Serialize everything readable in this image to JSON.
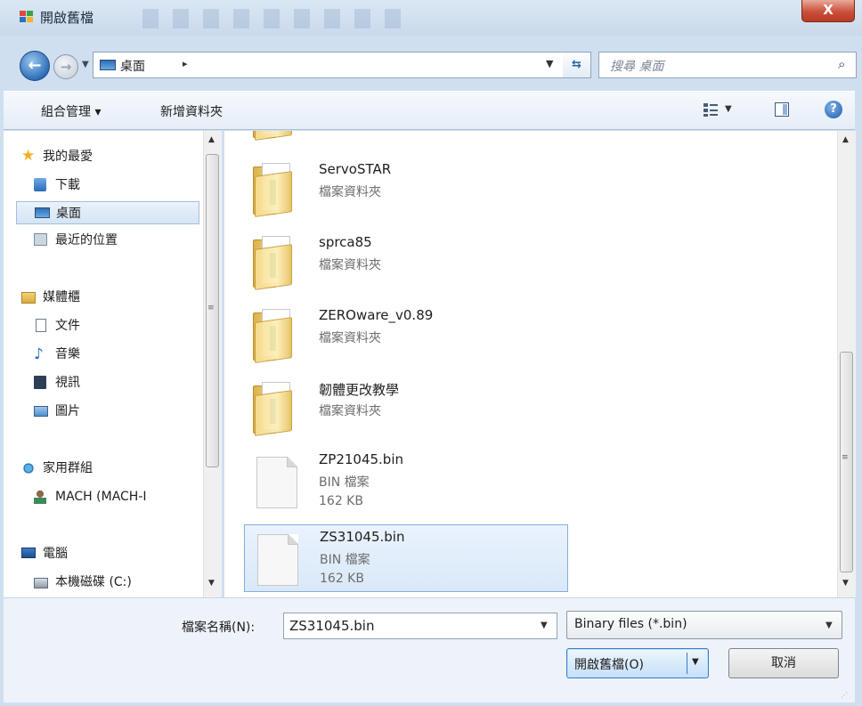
{
  "window": {
    "title": "開啟舊檔",
    "close_label": "X"
  },
  "address": {
    "location": "桌面",
    "separator": "▸",
    "search_placeholder": "搜尋 桌面"
  },
  "toolbar": {
    "organize_label": "組合管理 ▾",
    "new_folder_label": "新增資料夾"
  },
  "nav": {
    "favorites": {
      "header": "我的最愛",
      "items": [
        {
          "label": "下載",
          "icon": "download-icon"
        },
        {
          "label": "桌面",
          "icon": "desktop-icon",
          "selected": true
        },
        {
          "label": "最近的位置",
          "icon": "recent-places-icon"
        }
      ]
    },
    "libraries": {
      "header": "媒體櫃",
      "items": [
        {
          "label": "文件",
          "icon": "document-icon"
        },
        {
          "label": "音樂",
          "icon": "music-icon"
        },
        {
          "label": "視訊",
          "icon": "video-icon"
        },
        {
          "label": "圖片",
          "icon": "pictures-icon"
        }
      ]
    },
    "homegroup": {
      "header": "家用群組",
      "items": [
        {
          "label": "MACH (MACH-I",
          "icon": "user-icon"
        }
      ]
    },
    "computer": {
      "header": "電腦",
      "items": [
        {
          "label": "本機磁碟 (C:)",
          "icon": "drive-icon"
        }
      ]
    }
  },
  "files": [
    {
      "name": "ServoSTAR",
      "type": "檔案資料夾",
      "kind": "folder"
    },
    {
      "name": "sprca85",
      "type": "檔案資料夾",
      "kind": "folder"
    },
    {
      "name": "ZEROware_v0.89",
      "type": "檔案資料夾",
      "kind": "folder"
    },
    {
      "name": "韌體更改教學",
      "type": "檔案資料夾",
      "kind": "folder"
    },
    {
      "name": "ZP21045.bin",
      "type": "BIN 檔案",
      "size": "162 KB",
      "kind": "file"
    },
    {
      "name": "ZS31045.bin",
      "type": "BIN 檔案",
      "size": "162 KB",
      "kind": "file",
      "selected": true
    }
  ],
  "bottom": {
    "filename_label": "檔案名稱(N):",
    "filename_value": "ZS31045.bin",
    "filetype_value": "Binary files (*.bin)",
    "open_label": "開啟舊檔(O)",
    "cancel_label": "取消"
  },
  "colors": {
    "selection": "#d9e8f8",
    "toolbar": "#e5edf7",
    "close": "#c9503a"
  }
}
